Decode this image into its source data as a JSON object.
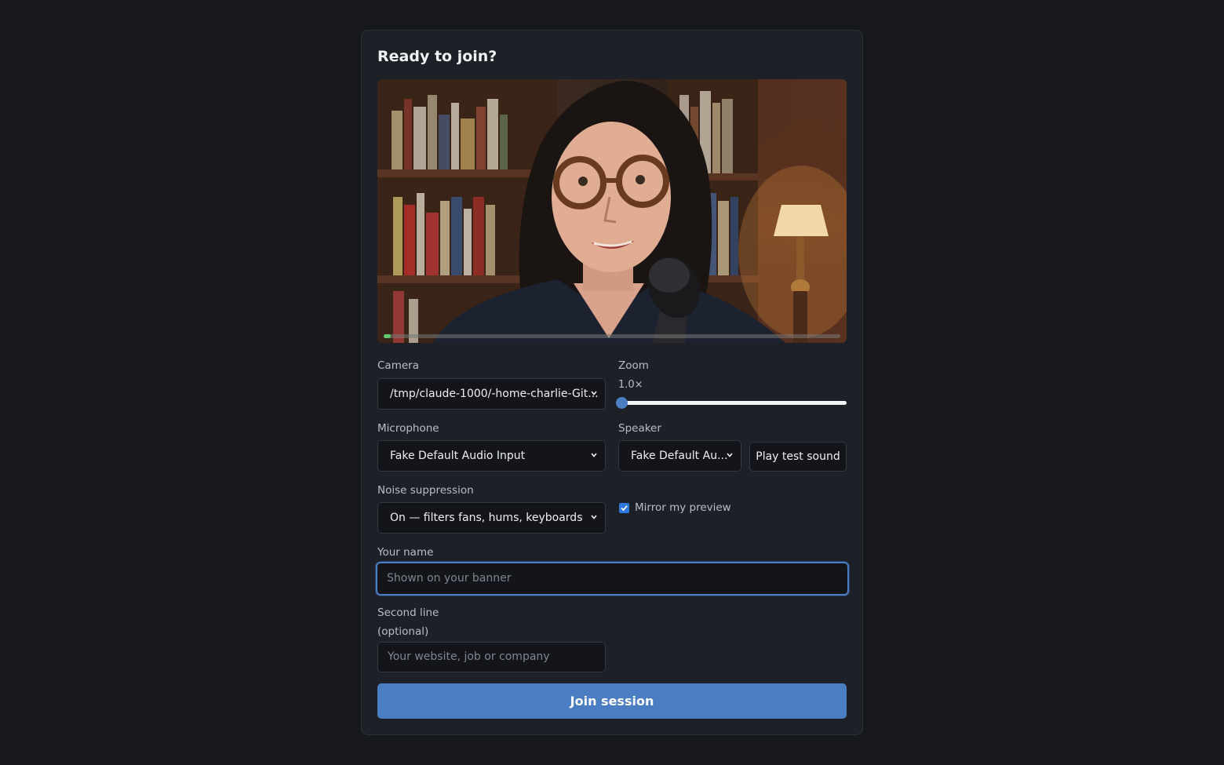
{
  "title": "Ready to join?",
  "preview": {
    "mic_level": 0.015
  },
  "camera": {
    "label": "Camera",
    "value": "/tmp/claude-1000/-home-charlie-Git..."
  },
  "zoom": {
    "label": "Zoom",
    "value_text": "1.0×",
    "value": 1.0,
    "level": 0
  },
  "microphone": {
    "label": "Microphone",
    "value": "Fake Default Audio Input"
  },
  "speaker": {
    "label": "Speaker",
    "value": "Fake Default Au...",
    "test_button": "Play test sound"
  },
  "noise": {
    "label": "Noise suppression",
    "value": "On — filters fans, hums, keyboards"
  },
  "mirror": {
    "label": "Mirror my preview",
    "checked": true
  },
  "name": {
    "label": "Your name",
    "placeholder": "Shown on your banner",
    "value": ""
  },
  "second_line": {
    "label_line1": "Second line",
    "label_line2": "(optional)",
    "placeholder": "Your website, job or company",
    "value": ""
  },
  "join_button": "Join session",
  "colors": {
    "accent": "#4b7dc2",
    "background": "#16181c",
    "card": "#1d2027",
    "level_green": "#5fc96a"
  }
}
